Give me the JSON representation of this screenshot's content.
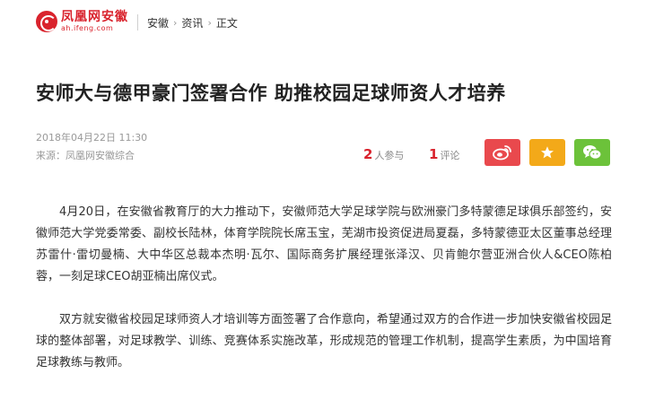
{
  "site": {
    "logo_cn": "凤凰网安徽",
    "logo_en": "ah.ifeng.com"
  },
  "breadcrumb": {
    "items": [
      "安徽",
      "资讯",
      "正文"
    ]
  },
  "article": {
    "title": "安师大与德甲豪门签署合作  助推校园足球师资人才培养",
    "date": "2018年04月22日 11:30",
    "source": "来源：凤凰网安徽综合",
    "participants_count": "2",
    "participants_label": "人参与",
    "comments_count": "1",
    "comments_label": "评论",
    "paragraphs": [
      "4月20日，在安徽省教育厅的大力推动下，安徽师范大学足球学院与欧洲豪门多特蒙德足球俱乐部签约，安徽师范大学党委常委、副校长陆林，体育学院院长席玉宝，芜湖市投资促进局夏磊，多特蒙德亚太区董事总经理苏雷什·雷切曼楠、大中华区总裁本杰明·瓦尔、国际商务扩展经理张泽汉、贝肯鲍尔营亚洲合伙人&CEO陈柏蓉，一刻足球CEO胡亚楠出席仪式。",
      "双方就安徽省校园足球师资人才培训等方面签署了合作意向，希望通过双方的合作进一步加快安徽省校园足球的整体部署，对足球教学、训练、竞赛体系实施改革，形成规范的管理工作机制，提高学生素质，为中国培育足球教练与教师。"
    ]
  },
  "share": {
    "weibo_icon": "weibo-icon",
    "favorite_icon": "star-icon",
    "wechat_icon": "wechat-icon",
    "colors": {
      "weibo": "#e9494d",
      "favorite": "#f3a919",
      "wechat": "#6cc23a",
      "brand": "#d9232d"
    }
  }
}
